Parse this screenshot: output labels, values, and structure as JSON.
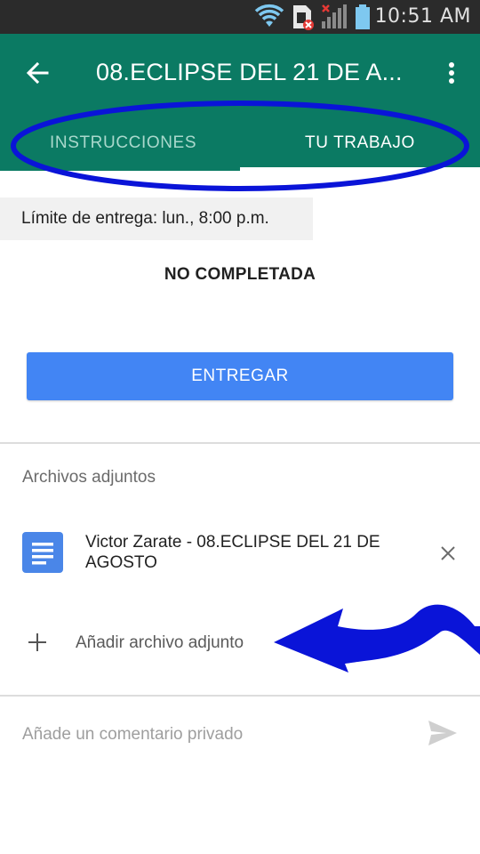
{
  "status_bar": {
    "time": "10:51 AM",
    "icons": [
      "wifi-icon",
      "sim-error-icon",
      "signal-icon",
      "battery-icon"
    ]
  },
  "app_bar": {
    "title": "08.ECLIPSE DEL 21 DE A...",
    "back_icon": "arrow-back-icon",
    "menu_icon": "more-vert-icon",
    "background": "#0b7a63"
  },
  "tabs": [
    {
      "label": "INSTRUCCIONES",
      "selected": false
    },
    {
      "label": "TU TRABAJO",
      "selected": true
    }
  ],
  "assignment": {
    "deadline": "Límite de entrega: lun., 8:00 p.m.",
    "status": "NO COMPLETADA",
    "submit_label": "ENTREGAR",
    "accent": "#4285f4"
  },
  "attachments": {
    "section_label": "Archivos adjuntos",
    "items": [
      {
        "name": "Victor Zarate - 08.ECLIPSE DEL 21 DE AGOSTO",
        "icon": "google-docs-icon"
      }
    ],
    "add_label": "Añadir archivo adjunto"
  },
  "comment": {
    "placeholder": "Añade un comentario privado",
    "send_icon": "send-icon"
  },
  "annotations": {
    "color": "#0a14d8"
  }
}
